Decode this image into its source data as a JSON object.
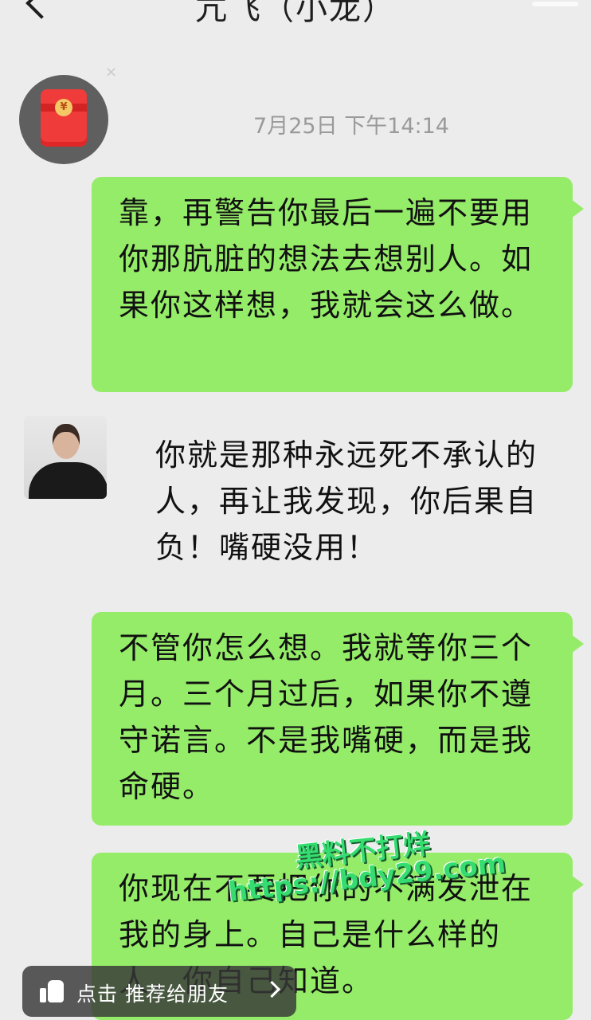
{
  "header": {
    "title": "亢飞（小龙）"
  },
  "chat": {
    "timestamp": "7月25日 下午14:14",
    "messages": [
      {
        "side": "outgoing",
        "text": "靠，再警告你最后一遍不要用你那肮脏的想法去想别人。如果你这样想，我就会这么做。"
      },
      {
        "side": "incoming",
        "text": "你就是那种永远死不承认的人，再让我发现，你后果自负！嘴硬没用！"
      },
      {
        "side": "outgoing",
        "text": "不管你怎么想。我就等你三个月。三个月过后，如果你不遵守诺言。不是我嘴硬，而是我命硬。"
      },
      {
        "side": "outgoing",
        "text": "你现在不要把你的不满发泄在我的身上。自己是什么样的人，你自己知道。"
      }
    ]
  },
  "watermark": {
    "line1": "黑料不打烊",
    "line2": "https://bdy29.com"
  },
  "share": {
    "label": "点击 推荐给朋友"
  },
  "icons": {
    "back": "back-chevron-icon",
    "red_packet": "red-packet-icon",
    "thumb": "thumbs-up-icon",
    "chevron": "chevron-right-icon"
  },
  "colors": {
    "background": "#ececec",
    "outgoing_bubble": "#95ec69",
    "red_packet": "#f03b3b"
  }
}
